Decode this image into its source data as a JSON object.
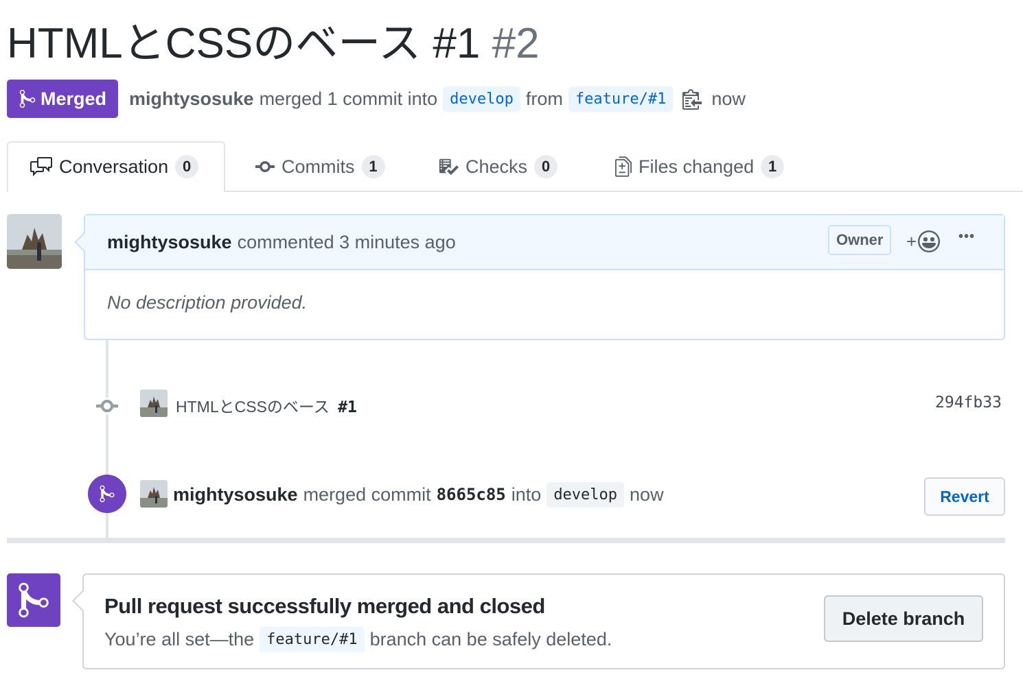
{
  "title": {
    "text": "HTMLとCSSのベース #1",
    "number": "#2"
  },
  "meta": {
    "status": "Merged",
    "author": "mightysosuke",
    "action": "merged 1 commit into",
    "base_branch": "develop",
    "from_text": "from",
    "head_branch": "feature/#1",
    "time": "now"
  },
  "tabs": [
    {
      "label": "Conversation",
      "count": "0",
      "icon": "comment-discussion-icon"
    },
    {
      "label": "Commits",
      "count": "1",
      "icon": "git-commit-icon"
    },
    {
      "label": "Checks",
      "count": "0",
      "icon": "checklist-icon"
    },
    {
      "label": "Files changed",
      "count": "1",
      "icon": "file-diff-icon"
    }
  ],
  "comment": {
    "author": "mightysosuke",
    "action": "commented 3 minutes ago",
    "role": "Owner",
    "reaction_plus": "+",
    "more": "•••",
    "body": "No description provided."
  },
  "commit": {
    "message": "HTMLとCSSのベース",
    "issue_ref": "#1",
    "sha": "294fb33"
  },
  "merge_event": {
    "author": "mightysosuke",
    "text1": "merged commit",
    "sha": "8665c85",
    "text2": "into",
    "branch": "develop",
    "time": "now",
    "revert_label": "Revert"
  },
  "merge_box": {
    "title": "Pull request successfully merged and closed",
    "sub_before": "You’re all set—the",
    "branch": "feature/#1",
    "sub_after": "branch can be safely deleted.",
    "delete_label": "Delete branch"
  },
  "colors": {
    "merged_purple": "#6f42c1",
    "link_blue": "#0366d6",
    "comment_border": "#c8e1ff"
  }
}
